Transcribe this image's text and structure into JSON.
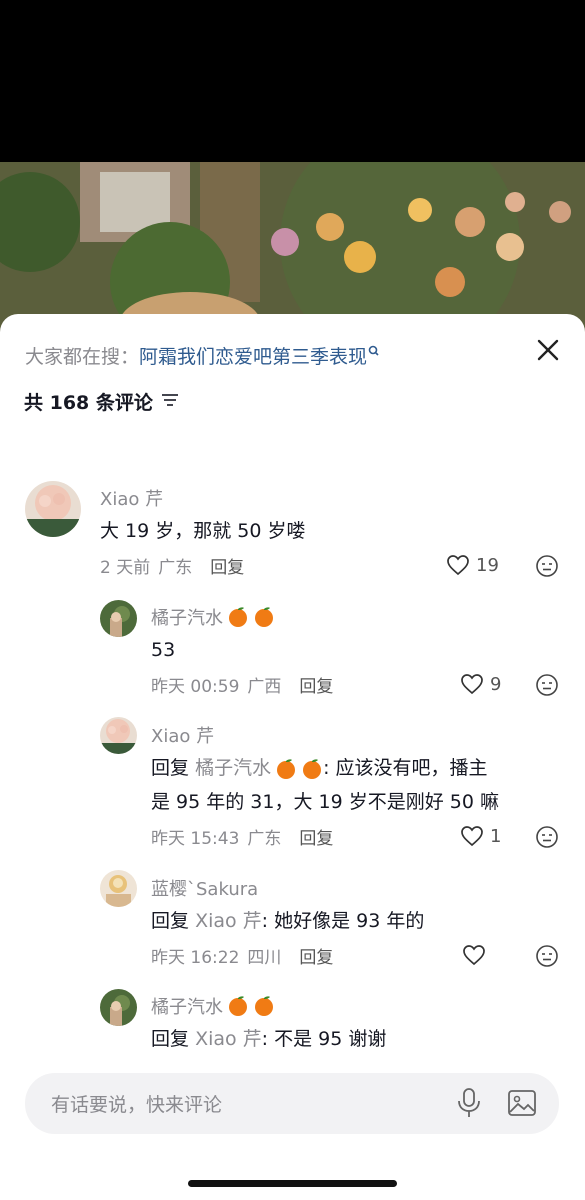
{
  "search": {
    "prefix": "大家都在搜：",
    "term": "阿霜我们恋爱吧第三季表现"
  },
  "header": {
    "count_label": "共 168 条评论"
  },
  "comments": [
    {
      "user": "Xiao 芹",
      "text": "大 19 岁，那就 50 岁喽",
      "time": "2 天前",
      "location": "广东",
      "reply_label": "回复",
      "likes": "19"
    },
    {
      "user": "橘子汽水",
      "text": "53",
      "time": "昨天 00:59",
      "location": "广西",
      "reply_label": "回复",
      "likes": "9"
    },
    {
      "user": "Xiao 芹",
      "reply_prefix": "回复",
      "reply_to": "橘子汽水",
      "text_line1": ": 应该没有吧，播主",
      "text_line2": "是 95 年的 31，大 19 岁不是刚好 50 嘛",
      "time": "昨天 15:43",
      "location": "广东",
      "reply_label": "回复",
      "likes": "1"
    },
    {
      "user": "蓝樱`Sakura",
      "reply_prefix": "回复",
      "reply_to": "Xiao 芹",
      "text": ": 她好像是 93 年的",
      "time": "昨天 16:22",
      "location": "四川",
      "reply_label": "回复",
      "likes": ""
    },
    {
      "user": "橘子汽水",
      "reply_prefix": "回复",
      "reply_to": "Xiao 芹",
      "text": ": 不是 95 谢谢"
    }
  ],
  "input": {
    "placeholder": "有话要说，快来评论"
  },
  "icons": {
    "close": "close-icon",
    "sort": "sort-icon",
    "like": "heart-icon",
    "emoji": "emoji-icon",
    "mic": "mic-icon",
    "image": "image-icon",
    "orange": "orange-emoji"
  },
  "colors": {
    "link": "#2f5b8f",
    "muted": "#8a8a8f",
    "text": "#161823",
    "input_bg": "#f2f2f4"
  }
}
